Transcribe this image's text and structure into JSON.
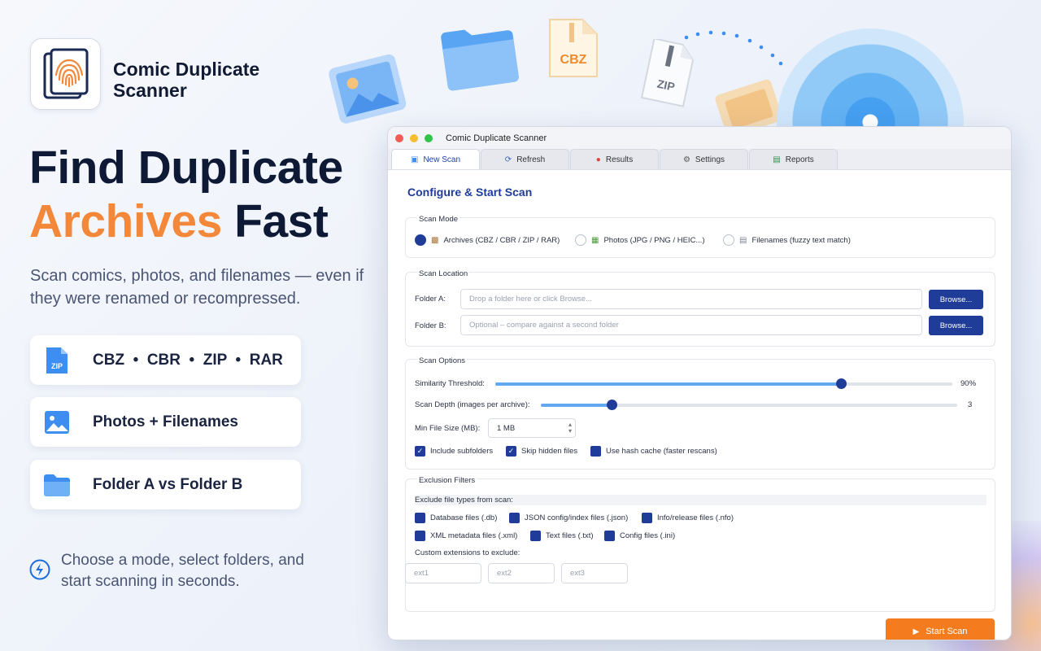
{
  "brand": {
    "app_name": "Comic Duplicate Scanner"
  },
  "hero": {
    "headline_line1": "Find Duplicate",
    "headline_accent": "Archives",
    "headline_rest": " Fast",
    "subline": "Scan comics, photos, and filenames — even if they were renamed or recompressed."
  },
  "features": [
    {
      "icon": "zip-file-icon",
      "label": "CBZ  •  CBR  •  ZIP  •  RAR"
    },
    {
      "icon": "image-icon",
      "label": "Photos + Filenames"
    },
    {
      "icon": "folder-icon",
      "label": "Folder A vs Folder B"
    }
  ],
  "tagline": "Choose a mode, select folders, and start scanning in seconds.",
  "deco": {
    "cbz_label": "CBZ",
    "zip_label": "ZIP"
  },
  "window": {
    "title": "Comic Duplicate Scanner",
    "tabs": [
      {
        "icon": "new-scan-icon",
        "label": "New Scan",
        "active": true
      },
      {
        "icon": "refresh-icon",
        "label": "Refresh",
        "active": false
      },
      {
        "icon": "results-icon",
        "label": "Results",
        "active": false
      },
      {
        "icon": "gear-icon",
        "label": "Settings",
        "active": false
      },
      {
        "icon": "chart-icon",
        "label": "Reports",
        "active": false
      }
    ],
    "section_title": "Configure & Start Scan",
    "scan_mode": {
      "label": "Scan Mode",
      "options": [
        {
          "label": "Archives (CBZ / CBR / ZIP / RAR)",
          "selected": true
        },
        {
          "label": "Photos (JPG / PNG / HEIC...)",
          "selected": false
        },
        {
          "label": "Filenames (fuzzy text match)",
          "selected": false
        }
      ]
    },
    "scan_location": {
      "label": "Scan Location",
      "folder_a_label": "Folder A:",
      "folder_a_placeholder": "Drop a folder here or click Browse...",
      "folder_b_label": "Folder B:",
      "folder_b_placeholder": "Optional – compare against a second folder",
      "browse_label": "Browse..."
    },
    "scan_options": {
      "label": "Scan Options",
      "similarity_label": "Similarity Threshold:",
      "similarity_value": "90%",
      "similarity_fraction": 0.9,
      "depth_label": "Scan Depth (images per archive):",
      "depth_value": "3",
      "depth_fraction": 0.17,
      "min_size_label": "Min File Size (MB):",
      "min_size_value": "1 MB",
      "checkboxes": [
        {
          "label": "Include subfolders",
          "checked": true
        },
        {
          "label": "Skip hidden files",
          "checked": true
        },
        {
          "label": "Use hash cache (faster rescans)",
          "checked": true
        }
      ]
    },
    "exclusion": {
      "label": "Exclusion Filters",
      "types_label": "Exclude file types from scan:",
      "types_row1": [
        "Database files (.db)",
        "JSON config/index files (.json)",
        "Info/release files (.nfo)"
      ],
      "types_row2": [
        "XML metadata files (.xml)",
        "Text files (.txt)",
        "Config files (.ini)"
      ],
      "custom_label": "Custom extensions to exclude:",
      "custom_placeholders": [
        "ext1",
        "ext2",
        "ext3"
      ]
    },
    "start_button": "Start Scan"
  },
  "colors": {
    "accent": "#f4883a",
    "primary": "#1f3c99",
    "start": "#f57c1e"
  }
}
